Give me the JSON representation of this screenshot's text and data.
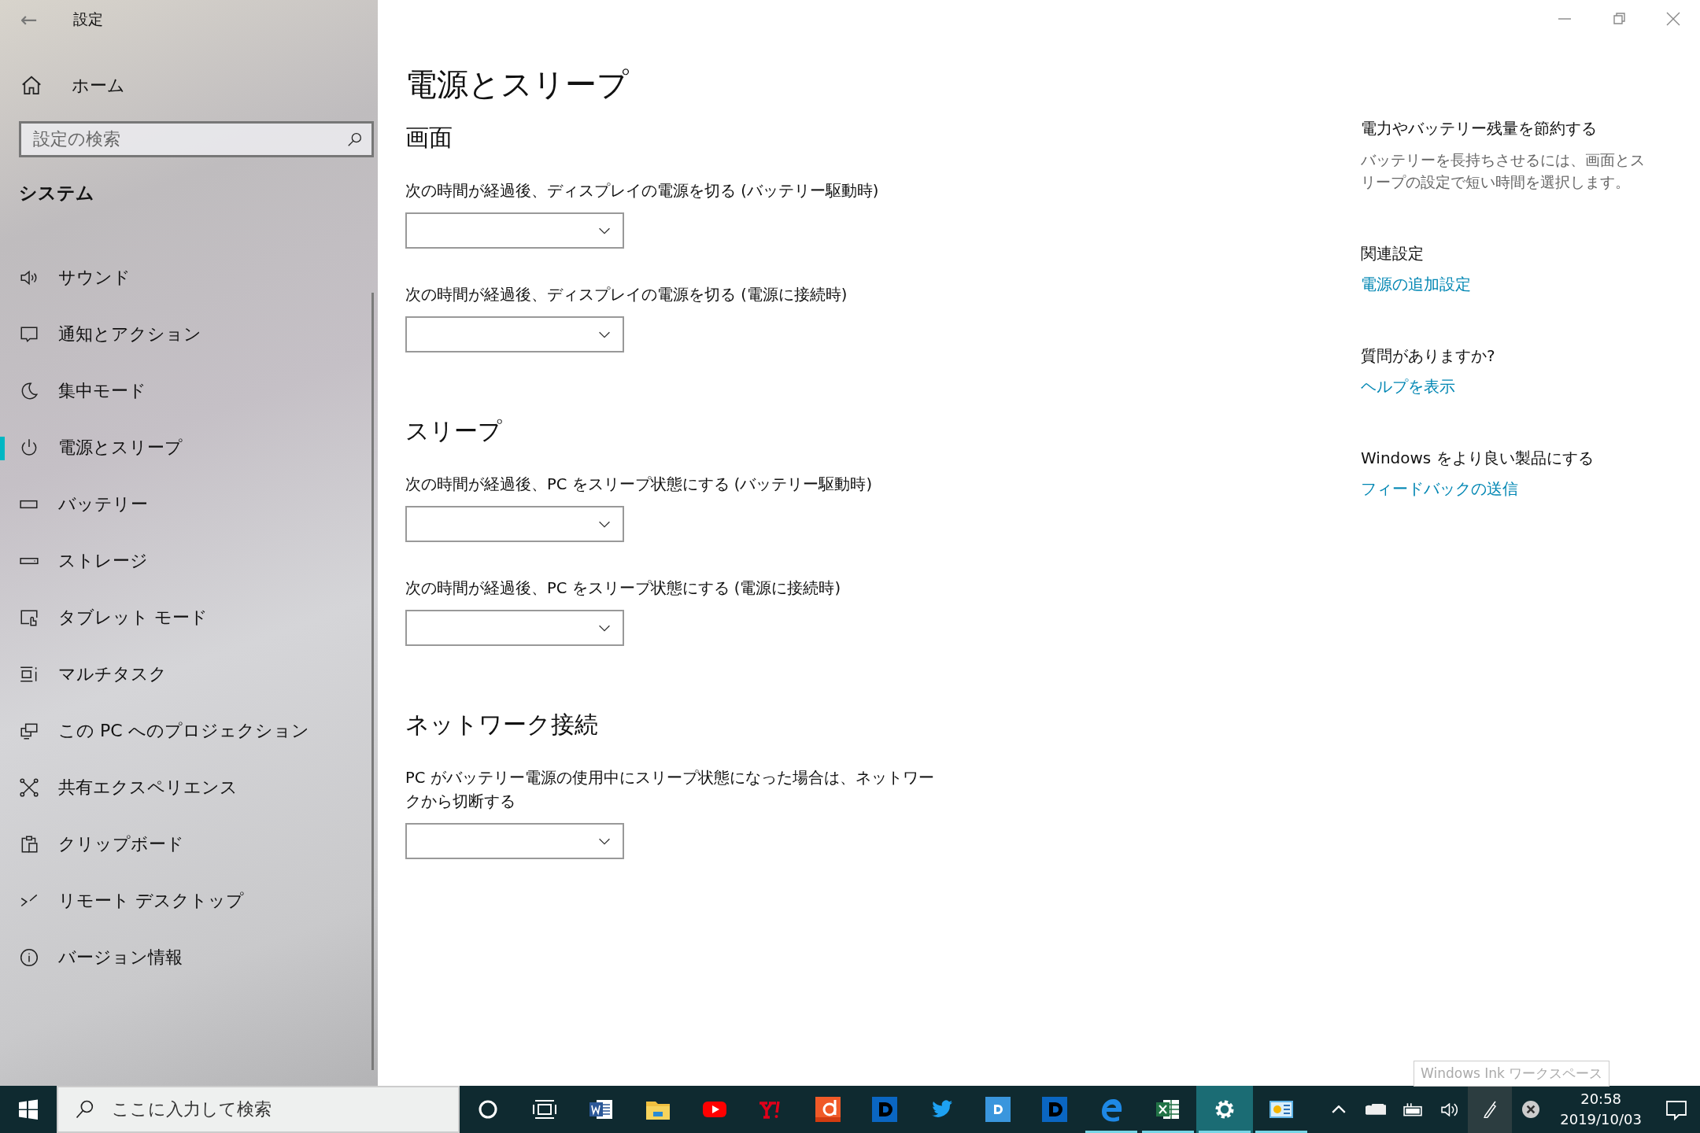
{
  "window": {
    "title": "設定",
    "back": "←"
  },
  "sidebar": {
    "home": "ホーム",
    "search": {
      "placeholder": "設定の検索"
    },
    "section": "システム",
    "items": [
      {
        "label": "サウンド",
        "selected": false
      },
      {
        "label": "通知とアクション",
        "selected": false
      },
      {
        "label": "集中モード",
        "selected": false
      },
      {
        "label": "電源とスリープ",
        "selected": true
      },
      {
        "label": "バッテリー",
        "selected": false
      },
      {
        "label": "ストレージ",
        "selected": false
      },
      {
        "label": "タブレット モード",
        "selected": false
      },
      {
        "label": "マルチタスク",
        "selected": false
      },
      {
        "label": "この PC へのプロジェクション",
        "selected": false
      },
      {
        "label": "共有エクスペリエンス",
        "selected": false
      },
      {
        "label": "クリップボード",
        "selected": false
      },
      {
        "label": "リモート デスクトップ",
        "selected": false
      },
      {
        "label": "バージョン情報",
        "selected": false
      }
    ]
  },
  "content": {
    "title": "電源とスリープ",
    "sections": [
      {
        "heading": "画面",
        "settings": [
          {
            "label": "次の時間が経過後、ディスプレイの電源を切る (バッテリー駆動時)"
          },
          {
            "label": "次の時間が経過後、ディスプレイの電源を切る (電源に接続時)"
          }
        ]
      },
      {
        "heading": "スリープ",
        "settings": [
          {
            "label": "次の時間が経過後、PC をスリープ状態にする (バッテリー駆動時)"
          },
          {
            "label": "次の時間が経過後、PC をスリープ状態にする (電源に接続時)"
          }
        ]
      },
      {
        "heading": "ネットワーク接続",
        "settings": [
          {
            "label": "PC がバッテリー電源の使用中にスリープ状態になった場合は、ネットワークから切断する"
          }
        ]
      }
    ]
  },
  "side_panel": [
    {
      "heading": "電力やバッテリー残量を節約する",
      "text": "バッテリーを長持ちさせるには、画面とスリープの設定で短い時間を選択します。"
    },
    {
      "heading": "関連設定",
      "link": "電源の追加設定"
    },
    {
      "heading": "質問がありますか?",
      "link": "ヘルプを表示"
    },
    {
      "heading": "Windows をより良い製品にする",
      "link": "フィードバックの送信"
    }
  ],
  "tooltip": "Windows Ink ワークスペース",
  "taskbar": {
    "search": {
      "placeholder": "ここに入力して検索"
    },
    "apps": [
      {
        "kind": "cortana",
        "running": false,
        "selected": false
      },
      {
        "kind": "taskview",
        "running": false,
        "selected": false
      },
      {
        "kind": "word",
        "running": false,
        "selected": false
      },
      {
        "kind": "explorer",
        "running": false,
        "selected": false
      },
      {
        "kind": "youtube",
        "running": false,
        "selected": false
      },
      {
        "kind": "yahoo",
        "running": false,
        "selected": false
      },
      {
        "kind": "anime",
        "running": false,
        "selected": false
      },
      {
        "kind": "dblack",
        "running": false,
        "selected": false
      },
      {
        "kind": "twitter",
        "running": false,
        "selected": false
      },
      {
        "kind": "dlight",
        "running": false,
        "selected": false
      },
      {
        "kind": "dblack",
        "running": false,
        "selected": false
      },
      {
        "kind": "edge",
        "running": true,
        "selected": false
      },
      {
        "kind": "excel",
        "running": true,
        "selected": false
      },
      {
        "kind": "settings",
        "running": true,
        "selected": true
      },
      {
        "kind": "control",
        "running": true,
        "selected": false
      }
    ],
    "time": "20:58",
    "date": "2019/10/03"
  }
}
